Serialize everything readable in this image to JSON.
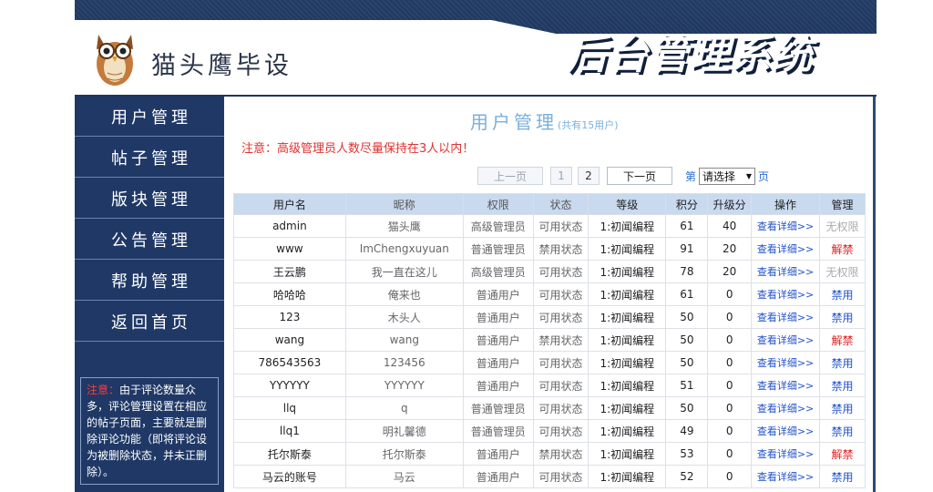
{
  "brand": {
    "name": "猫头鹰毕设",
    "system_title": "后台管理系统"
  },
  "sidebar": {
    "items": [
      {
        "label": "用户管理"
      },
      {
        "label": "帖子管理"
      },
      {
        "label": "版块管理"
      },
      {
        "label": "公告管理"
      },
      {
        "label": "帮助管理"
      },
      {
        "label": "返回首页"
      }
    ],
    "notice_label": "注意：",
    "notice_text": "由于评论数量众多，评论管理设置在相应的帖子页面，主要就是删除评论功能（即将评论设为被删除状态，并未正删除）。"
  },
  "main": {
    "title": "用户管理",
    "count": "(共有15用户)",
    "warning": "注意：高级管理员人数尽量保持在3人以内！",
    "pager": {
      "prev": "上一页",
      "page1": "1",
      "page2": "2",
      "next": "下一页",
      "jump_prefix": "第",
      "select_value": "请选择",
      "jump_suffix": "页"
    }
  },
  "table": {
    "headers": [
      "用户名",
      "昵称",
      "权限",
      "状态",
      "等级",
      "积分",
      "升级分",
      "操作",
      "管理"
    ],
    "rows": [
      {
        "username": "admin",
        "nickname": "猫头鹰",
        "role": "高级管理员",
        "status": "可用状态",
        "level": "1:初闻编程",
        "points": "61",
        "upgrade": "40",
        "detail": "查看详细>>",
        "manage": "无权限",
        "manage_color": "gray"
      },
      {
        "username": "www",
        "nickname": "ImChengxuyuan",
        "role": "普通管理员",
        "status": "禁用状态",
        "level": "1:初闻编程",
        "points": "91",
        "upgrade": "20",
        "detail": "查看详细>>",
        "manage": "解禁",
        "manage_color": "red"
      },
      {
        "username": "王云鹏",
        "nickname": "我一直在这儿",
        "role": "高级管理员",
        "status": "可用状态",
        "level": "1:初闻编程",
        "points": "78",
        "upgrade": "20",
        "detail": "查看详细>>",
        "manage": "无权限",
        "manage_color": "gray"
      },
      {
        "username": "哈哈哈",
        "nickname": "俺来也",
        "role": "普通用户",
        "status": "可用状态",
        "level": "1:初闻编程",
        "points": "61",
        "upgrade": "0",
        "detail": "查看详细>>",
        "manage": "禁用",
        "manage_color": "blue"
      },
      {
        "username": "123",
        "nickname": "木头人",
        "role": "普通用户",
        "status": "可用状态",
        "level": "1:初闻编程",
        "points": "50",
        "upgrade": "0",
        "detail": "查看详细>>",
        "manage": "禁用",
        "manage_color": "blue"
      },
      {
        "username": "wang",
        "nickname": "wang",
        "role": "普通用户",
        "status": "禁用状态",
        "level": "1:初闻编程",
        "points": "50",
        "upgrade": "0",
        "detail": "查看详细>>",
        "manage": "解禁",
        "manage_color": "red"
      },
      {
        "username": "786543563",
        "nickname": "123456",
        "role": "普通用户",
        "status": "可用状态",
        "level": "1:初闻编程",
        "points": "50",
        "upgrade": "0",
        "detail": "查看详细>>",
        "manage": "禁用",
        "manage_color": "blue"
      },
      {
        "username": "YYYYYY",
        "nickname": "YYYYYY",
        "role": "普通用户",
        "status": "可用状态",
        "level": "1:初闻编程",
        "points": "51",
        "upgrade": "0",
        "detail": "查看详细>>",
        "manage": "禁用",
        "manage_color": "blue"
      },
      {
        "username": "llq",
        "nickname": "q",
        "role": "普通管理员",
        "status": "可用状态",
        "level": "1:初闻编程",
        "points": "50",
        "upgrade": "0",
        "detail": "查看详细>>",
        "manage": "禁用",
        "manage_color": "blue"
      },
      {
        "username": "llq1",
        "nickname": "明礼馨德",
        "role": "普通管理员",
        "status": "可用状态",
        "level": "1:初闻编程",
        "points": "49",
        "upgrade": "0",
        "detail": "查看详细>>",
        "manage": "禁用",
        "manage_color": "blue"
      },
      {
        "username": "托尔斯泰",
        "nickname": "托尔斯泰",
        "role": "普通用户",
        "status": "禁用状态",
        "level": "1:初闻编程",
        "points": "53",
        "upgrade": "0",
        "detail": "查看详细>>",
        "manage": "解禁",
        "manage_color": "red"
      },
      {
        "username": "马云的账号",
        "nickname": "马云",
        "role": "普通用户",
        "status": "可用状态",
        "level": "1:初闻编程",
        "points": "52",
        "upgrade": "0",
        "detail": "查看详细>>",
        "manage": "禁用",
        "manage_color": "blue"
      }
    ]
  }
}
